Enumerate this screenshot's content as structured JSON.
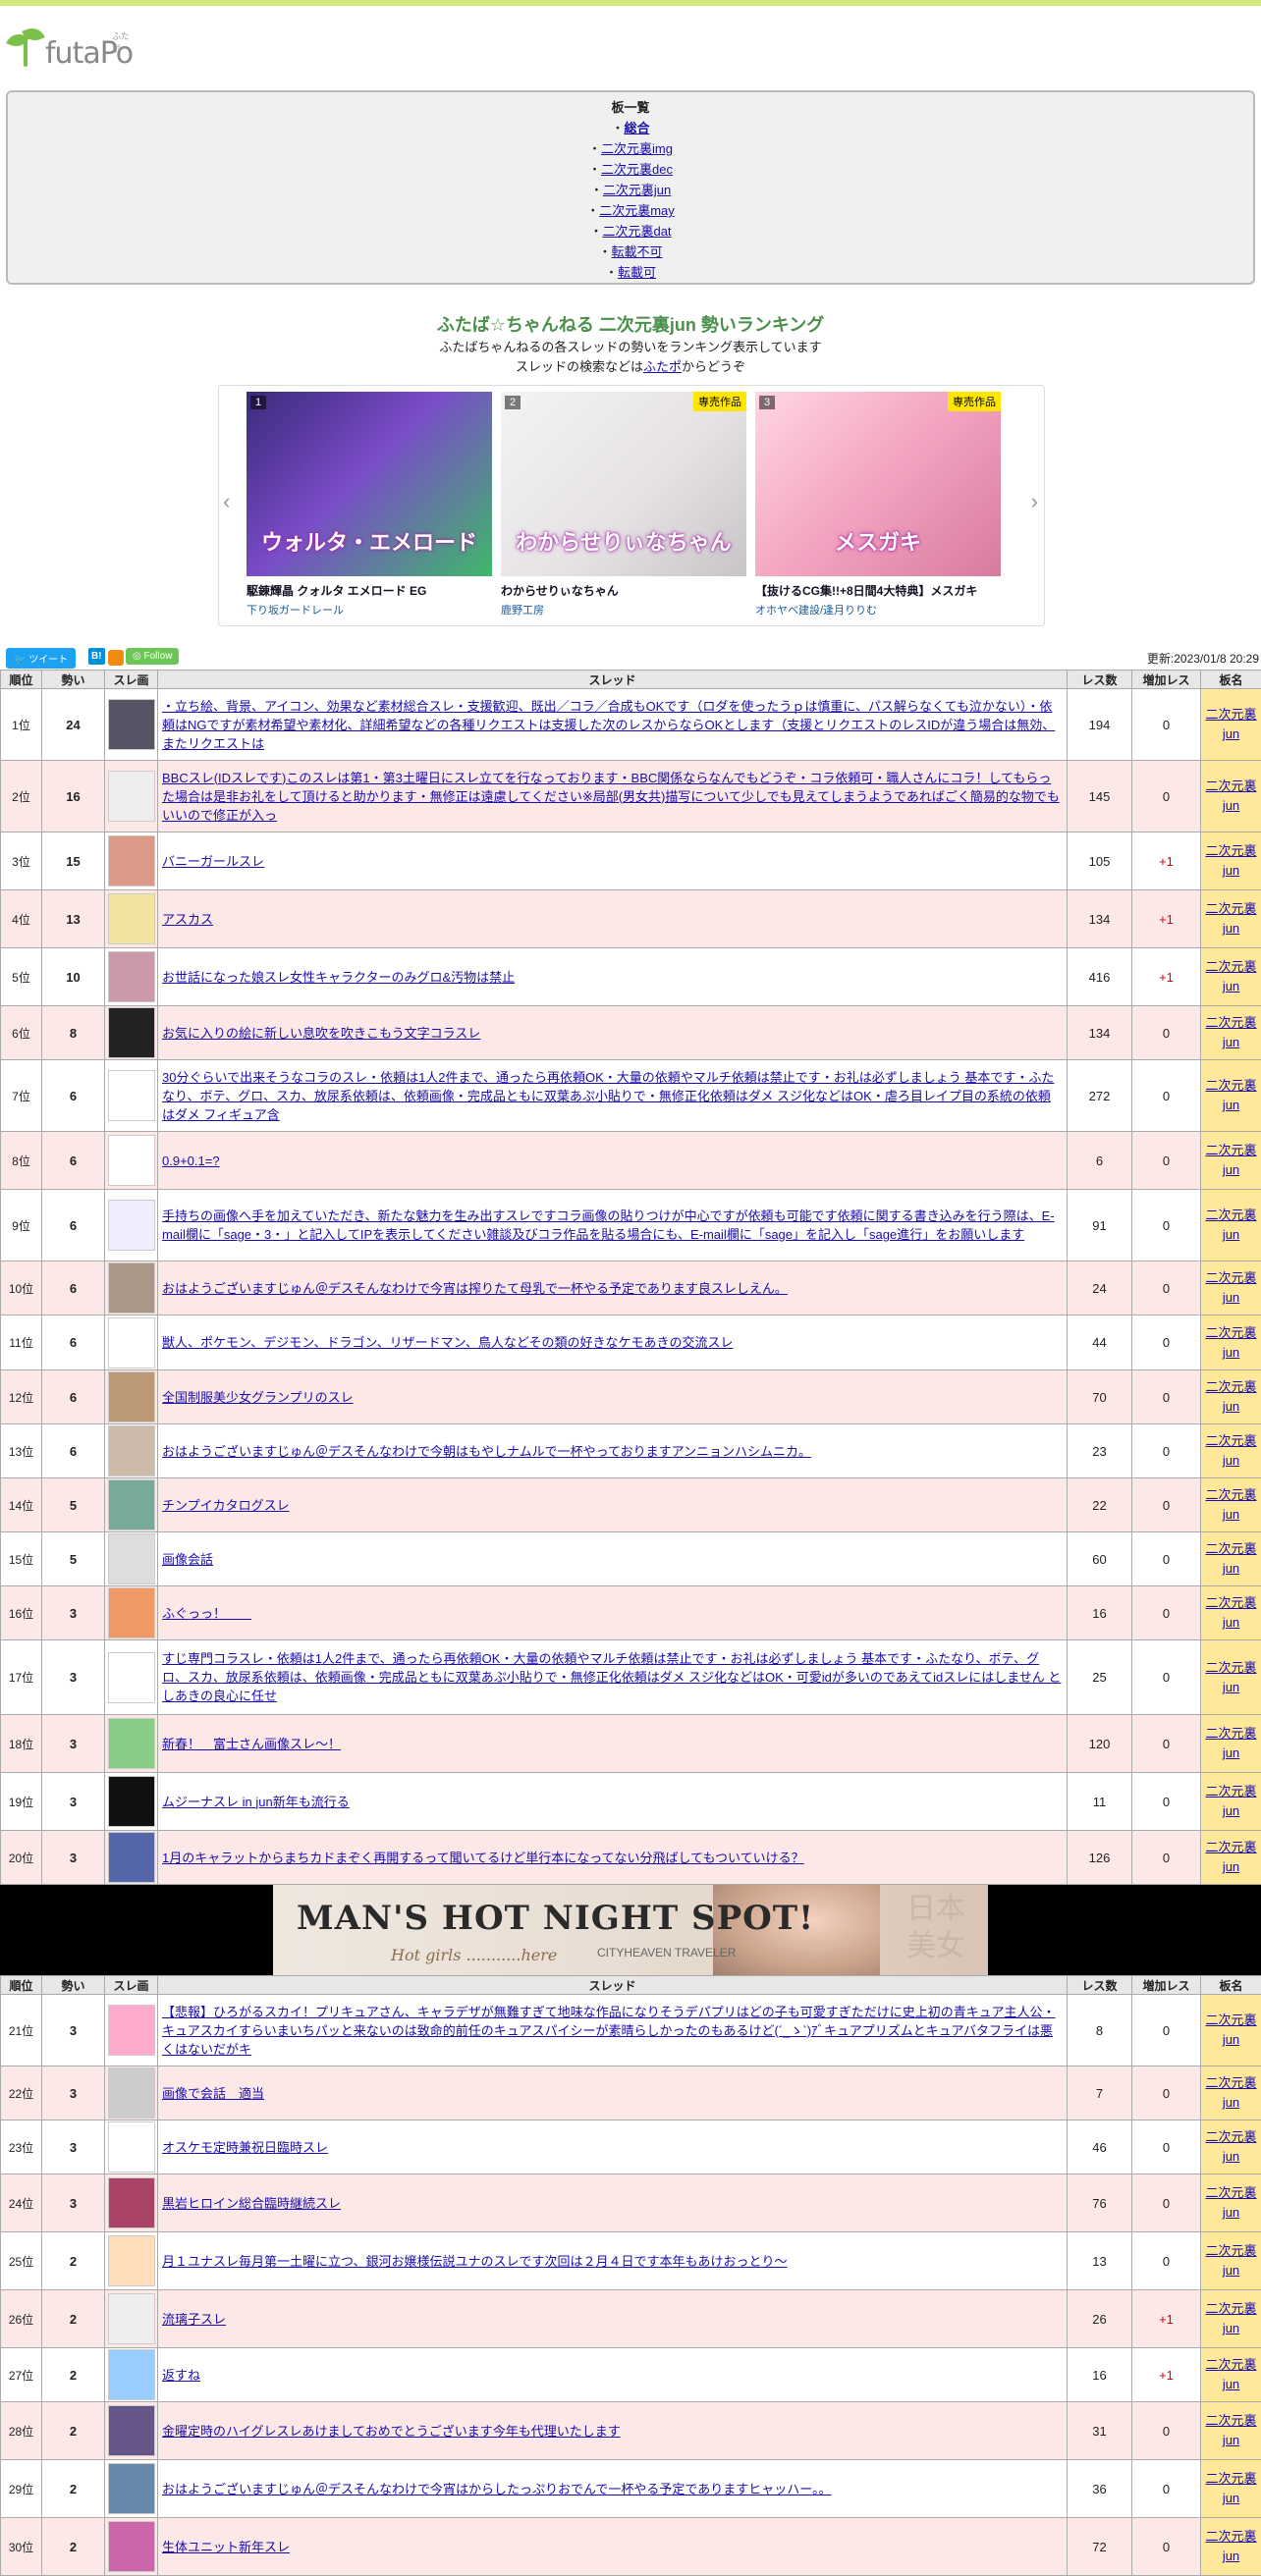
{
  "site": {
    "logo_text": "futaPo",
    "logo_ruby": "ふたポ"
  },
  "boards": {
    "title": "板一覧",
    "items": [
      {
        "label": "総合",
        "current": true
      },
      {
        "label": "二次元裏img",
        "current": false
      },
      {
        "label": "二次元裏dec",
        "current": false
      },
      {
        "label": "二次元裏jun",
        "current": false
      },
      {
        "label": "二次元裏may",
        "current": false
      },
      {
        "label": "二次元裏dat",
        "current": false
      },
      {
        "label": "転載不可",
        "current": false
      },
      {
        "label": "転載可",
        "current": false
      }
    ]
  },
  "heading": {
    "title": "ふたば☆ちゃんねる 二次元裏jun 勢いランキング",
    "desc1": "ふたばちゃんねるの各スレッドの勢いをランキング表示しています",
    "desc2_pre": "スレッドの検索などは",
    "desc2_link": "ふたポ",
    "desc2_post": "からどうぞ"
  },
  "carousel": {
    "cards": [
      {
        "num": "1",
        "tag": "",
        "art": "ウォルタ・エメロード",
        "title": "駆錬輝晶 クォルタ エメロード EG",
        "circle": "下り坂ガードレール",
        "bg": "linear-gradient(135deg,#3a2a7a 0%,#7a4cc8 45%,#3fb86a 100%)"
      },
      {
        "num": "2",
        "tag": "専売作品",
        "art": "わからせりぃなちゃん",
        "title": "わからせりぃなちゃん",
        "circle": "鹿野工房",
        "bg": "linear-gradient(135deg,#f4f4f4 0%,#e6e2e6 55%,#c9c4c8 100%)"
      },
      {
        "num": "3",
        "tag": "専売作品",
        "art": "メスガキ",
        "title": "【抜けるCG集!!+8日間4大特典】メスガキ",
        "circle": "オホヤベ建設/逢月りりむ",
        "bg": "linear-gradient(135deg,#ffd6e4 0%,#f3a3c0 50%,#d87aa0 100%)"
      }
    ]
  },
  "toolbar": {
    "tweet": "ツイート",
    "hatena": "B!",
    "follow": "Follow",
    "updated": "更新:2023/01/8 20:29"
  },
  "table": {
    "headers": {
      "pos": "順位",
      "momentum": "勢い",
      "thumb": "スレ画",
      "thread": "スレッド",
      "res": "レス数",
      "inc": "増加レス",
      "board": "板名"
    },
    "board_line1": "二次元裏",
    "board_line2": "jun",
    "rows_a": [
      {
        "pos": "1位",
        "momentum": "24",
        "title": "・立ち絵、背景、アイコン、効果など素材総合スレ・支援歓迎、既出／コラ／合成もOKです（ロダを使ったうｐは慎重に、パス解らなくても泣かない）・依頼はNGですが素材希望や素材化、詳細希望などの各種リクエストは支援した次のレスからならOKとします（支援とリクエストのレスIDが違う場合は無効、またリクエストは",
        "res": "194",
        "inc": "0",
        "thumb": "#556",
        "h": 73
      },
      {
        "pos": "2位",
        "momentum": "16",
        "title": "BBCスレ(IDスレです)このスレは第1・第3土曜日にスレ立てを行なっております・BBC関係ならなんでもどうぞ・コラ依頼可・職人さんにコラ！してもらった場合は是非お礼をして頂けると助かります・無修正は遠慮してください※局部(男女共)描写について少しでも見えてしまうようであればごく簡易的な物でもいいので修正が入っ",
        "res": "145",
        "inc": "0",
        "thumb": "#eee",
        "h": 73
      },
      {
        "pos": "3位",
        "momentum": "15",
        "title": "バニーガールスレ",
        "res": "105",
        "inc": "+1",
        "thumb": "#d98",
        "h": 59
      },
      {
        "pos": "4位",
        "momentum": "13",
        "title": "アスカス",
        "res": "134",
        "inc": "+1",
        "thumb": "#f1e3a0",
        "h": 59
      },
      {
        "pos": "5位",
        "momentum": "10",
        "title": "お世話になった娘スレ女性キャラクターのみグロ&汚物は禁止",
        "res": "416",
        "inc": "+1",
        "thumb": "#c9a",
        "h": 59
      },
      {
        "pos": "6位",
        "momentum": "8",
        "title": "お気に入りの絵に新しい息吹を吹きこもう文字コラスレ",
        "res": "134",
        "inc": "0",
        "thumb": "#222",
        "h": 46
      },
      {
        "pos": "7位",
        "momentum": "6",
        "title": "30分ぐらいで出来そうなコラのスレ・依頼は1人2件まで、通ったら再依頼OK・大量の依頼やマルチ依頼は禁止です・お礼は必ずしましょう 基本です・ふたなり、ボテ、グロ、スカ、放尿系依頼は、依頼画像・完成品ともに双葉あぷ小貼りで・無修正化依頼はダメ スジ化などはOK・虐ろ目レイプ目の系統の依頼はダメ フィギュア含",
        "res": "272",
        "inc": "0",
        "thumb": "#fff",
        "h": 73
      },
      {
        "pos": "8位",
        "momentum": "6",
        "title": "0.9+0.1=?",
        "res": "6",
        "inc": "0",
        "thumb": "#fff",
        "h": 59
      },
      {
        "pos": "9位",
        "momentum": "6",
        "title": "手持ちの画像へ手を加えていただき、新たな魅力を生み出すスレですコラ画像の貼りつけが中心ですが依頼も可能です依頼に関する書き込みを行う際は、E-mail欄に「sage・3・」と記入してIPを表示してください雑談及びコラ作品を貼る場合にも、E-mail欄に「sage」を記入し「sage進行」をお願いします",
        "res": "91",
        "inc": "0",
        "thumb": "#eef",
        "h": 73
      },
      {
        "pos": "10位",
        "momentum": "6",
        "title": "おはようございますじゅん＠デスそんなわけで今宵は搾りたて母乳で一杯やる予定であります良スレしえん。",
        "res": "24",
        "inc": "0",
        "thumb": "#a98",
        "h": 50
      },
      {
        "pos": "11位",
        "momentum": "6",
        "title": "獣人、ポケモン、デジモン、ドラゴン、リザードマン、鳥人などその類の好きなケモあきの交流スレ",
        "res": "44",
        "inc": "0",
        "thumb": "#fff",
        "h": 56
      },
      {
        "pos": "12位",
        "momentum": "6",
        "title": "全国制服美少女グランプリのスレ",
        "res": "70",
        "inc": "0",
        "thumb": "#b97",
        "h": 48
      },
      {
        "pos": "13位",
        "momentum": "6",
        "title": "おはようございますじゅん＠デスそんなわけで今朝はもやしナムルで一杯やっておりますアンニョンハシムニカ。",
        "res": "23",
        "inc": "0",
        "thumb": "#cba",
        "h": 48
      },
      {
        "pos": "14位",
        "momentum": "5",
        "title": "チンプイカタログスレ",
        "res": "22",
        "inc": "0",
        "thumb": "#7a9",
        "h": 40
      },
      {
        "pos": "15位",
        "momentum": "5",
        "title": "画像会話",
        "res": "60",
        "inc": "0",
        "thumb": "#ddd",
        "h": 46
      },
      {
        "pos": "16位",
        "momentum": "3",
        "title": "ふぐっっ！＿＿",
        "res": "16",
        "inc": "0",
        "thumb": "#e96",
        "h": 46
      },
      {
        "pos": "17位",
        "momentum": "3",
        "title": "すじ専門コラスレ・依頼は1人2件まで、通ったら再依頼OK・大量の依頼やマルチ依頼は禁止です・お礼は必ずしましょう 基本です・ふたなり、ボテ、グロ、スカ、放尿系依頼は、依頼画像・完成品ともに双葉あぷ小貼りで・無修正化依頼はダメ スジ化などはOK・可愛idが多いのであえてidスレにはしません としあきの良心に任せ",
        "res": "25",
        "inc": "0",
        "thumb": "#fff",
        "h": 76
      },
      {
        "pos": "18位",
        "momentum": "3",
        "title": "新春！　富士さん画像スレ～！",
        "res": "120",
        "inc": "0",
        "thumb": "#8c8",
        "h": 59
      },
      {
        "pos": "19位",
        "momentum": "3",
        "title": "ムジーナスレ in jun新年も流行る",
        "res": "11",
        "inc": "0",
        "thumb": "#111",
        "h": 59
      },
      {
        "pos": "20位",
        "momentum": "3",
        "title": "1月のキャラットからまちカドまぞく再開するって聞いてるけど単行本になってない分飛ばしてもついていける？",
        "res": "126",
        "inc": "0",
        "thumb": "#56a",
        "h": 46
      }
    ],
    "ad": {
      "big": "MAN'S HOT NIGHT SPOT!",
      "small": "Hot girls ...........here",
      "brand": "CITYHEAVEN TRAVELER",
      "jp": "日本美女"
    },
    "rows_b": [
      {
        "pos": "21位",
        "momentum": "3",
        "title": "【悲報】ひろがるスカイ！プリキュアさん、キャラデザが無難すぎて地味な作品になりそうデパプリはどの子も可愛すぎただけに史上初の青キュア主人公・キュアスカイすらいまいちパッと来ないのは致命的前任のキュアスパイシーが素晴らしかったのもあるけど(´_ゝ`)ｱﾞキュアプリズムとキュアバタフライは悪くはないだがキ",
        "res": "8",
        "inc": "0",
        "thumb": "#fac",
        "h": 73
      },
      {
        "pos": "22位",
        "momentum": "3",
        "title": "画像で会話　適当",
        "res": "7",
        "inc": "0",
        "thumb": "#ccc",
        "h": 41
      },
      {
        "pos": "23位",
        "momentum": "3",
        "title": "オスケモ定時兼祝日臨時スレ",
        "res": "46",
        "inc": "0",
        "thumb": "#fff",
        "h": 46
      },
      {
        "pos": "24位",
        "momentum": "3",
        "title": "黒岩ヒロイン総合臨時継続スレ",
        "res": "76",
        "inc": "0",
        "thumb": "#a46",
        "h": 59
      },
      {
        "pos": "25位",
        "momentum": "2",
        "title": "月１ユナスレ毎月第一土曜に立つ、銀河お嬢様伝説ユナのスレです次回は２月４日です本年もあけおっとり～",
        "res": "13",
        "inc": "0",
        "thumb": "#fdb",
        "h": 59
      },
      {
        "pos": "26位",
        "momentum": "2",
        "title": "流璃子スレ",
        "res": "26",
        "inc": "+1",
        "thumb": "#eee",
        "h": 59
      },
      {
        "pos": "27位",
        "momentum": "2",
        "title": "返すね",
        "res": "16",
        "inc": "+1",
        "thumb": "#9cf",
        "h": 46
      },
      {
        "pos": "28位",
        "momentum": "2",
        "title": "金曜定時のハイグレスレあけましておめでとうございます今年も代理いたします",
        "res": "31",
        "inc": "0",
        "thumb": "#658",
        "h": 59
      },
      {
        "pos": "29位",
        "momentum": "2",
        "title": "おはようございますじゅん＠デスそんなわけで今宵はからしたっぷりおでんで一杯やる予定でありますヒャッハー。。",
        "res": "36",
        "inc": "0",
        "thumb": "#68a",
        "h": 59
      },
      {
        "pos": "30位",
        "momentum": "2",
        "title": "生体ユニット新年スレ",
        "res": "72",
        "inc": "0",
        "thumb": "#c6a",
        "h": 59
      }
    ]
  }
}
